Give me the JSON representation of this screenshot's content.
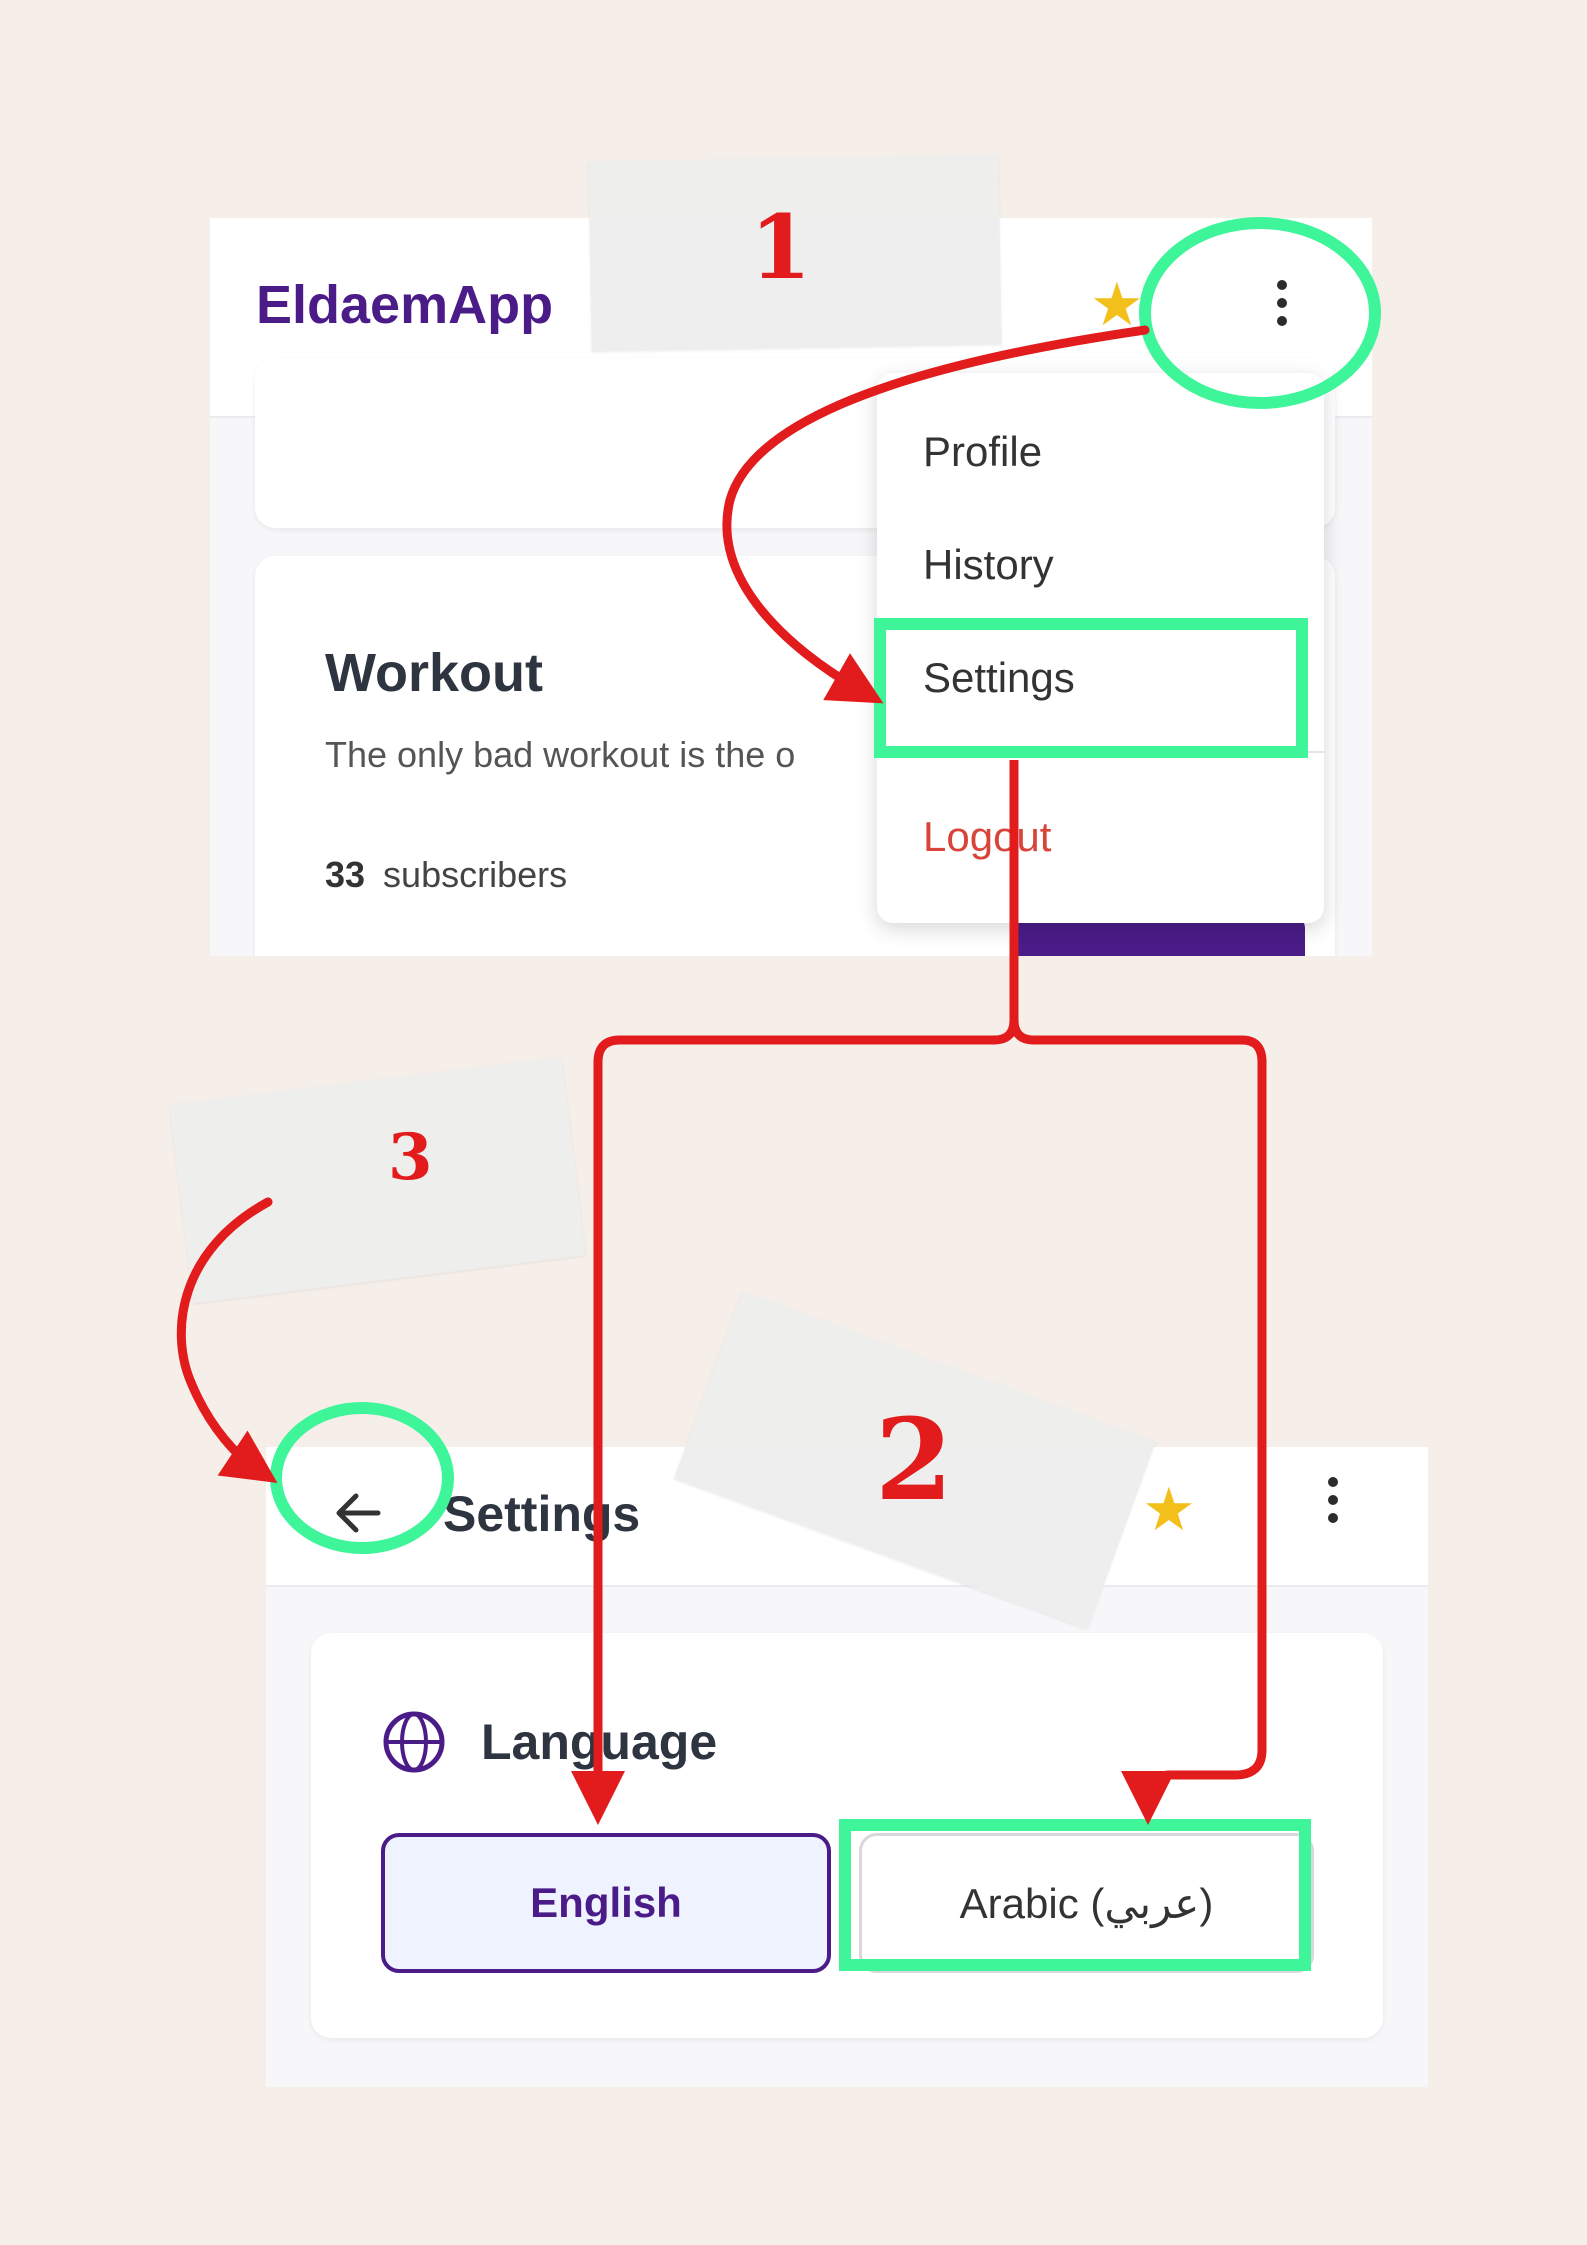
{
  "top_screen": {
    "app_title": "EldaemApp",
    "menu": {
      "items": [
        "Profile",
        "History",
        "Settings"
      ],
      "logout_label": "Logout"
    },
    "workout_card": {
      "title": "Workout",
      "description": "The only bad workout is the o",
      "subscriber_count": "33",
      "subscribers_label": "subscribers"
    }
  },
  "bottom_screen": {
    "title": "Settings",
    "language_card": {
      "title": "Language",
      "options": [
        "English",
        "Arabic (عربي)"
      ],
      "selected": "English"
    }
  },
  "annotations": {
    "steps": [
      "1",
      "2",
      "3"
    ],
    "highlight_color": "#3ef59a",
    "arrow_color": "#e21c1c"
  },
  "colors": {
    "brand": "#4b1c88",
    "logout": "#d9443a",
    "background": "#f6efe9"
  }
}
